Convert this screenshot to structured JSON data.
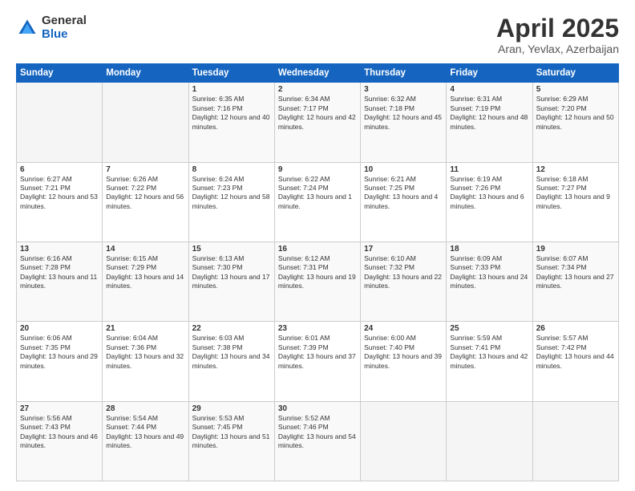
{
  "header": {
    "logo_general": "General",
    "logo_blue": "Blue",
    "title": "April 2025",
    "subtitle": "Aran, Yevlax, Azerbaijan"
  },
  "weekdays": [
    "Sunday",
    "Monday",
    "Tuesday",
    "Wednesday",
    "Thursday",
    "Friday",
    "Saturday"
  ],
  "weeks": [
    [
      {
        "day": "",
        "sunrise": "",
        "sunset": "",
        "daylight": "",
        "empty": true
      },
      {
        "day": "",
        "sunrise": "",
        "sunset": "",
        "daylight": "",
        "empty": true
      },
      {
        "day": "1",
        "sunrise": "Sunrise: 6:35 AM",
        "sunset": "Sunset: 7:16 PM",
        "daylight": "Daylight: 12 hours and 40 minutes.",
        "empty": false
      },
      {
        "day": "2",
        "sunrise": "Sunrise: 6:34 AM",
        "sunset": "Sunset: 7:17 PM",
        "daylight": "Daylight: 12 hours and 42 minutes.",
        "empty": false
      },
      {
        "day": "3",
        "sunrise": "Sunrise: 6:32 AM",
        "sunset": "Sunset: 7:18 PM",
        "daylight": "Daylight: 12 hours and 45 minutes.",
        "empty": false
      },
      {
        "day": "4",
        "sunrise": "Sunrise: 6:31 AM",
        "sunset": "Sunset: 7:19 PM",
        "daylight": "Daylight: 12 hours and 48 minutes.",
        "empty": false
      },
      {
        "day": "5",
        "sunrise": "Sunrise: 6:29 AM",
        "sunset": "Sunset: 7:20 PM",
        "daylight": "Daylight: 12 hours and 50 minutes.",
        "empty": false
      }
    ],
    [
      {
        "day": "6",
        "sunrise": "Sunrise: 6:27 AM",
        "sunset": "Sunset: 7:21 PM",
        "daylight": "Daylight: 12 hours and 53 minutes.",
        "empty": false
      },
      {
        "day": "7",
        "sunrise": "Sunrise: 6:26 AM",
        "sunset": "Sunset: 7:22 PM",
        "daylight": "Daylight: 12 hours and 56 minutes.",
        "empty": false
      },
      {
        "day": "8",
        "sunrise": "Sunrise: 6:24 AM",
        "sunset": "Sunset: 7:23 PM",
        "daylight": "Daylight: 12 hours and 58 minutes.",
        "empty": false
      },
      {
        "day": "9",
        "sunrise": "Sunrise: 6:22 AM",
        "sunset": "Sunset: 7:24 PM",
        "daylight": "Daylight: 13 hours and 1 minute.",
        "empty": false
      },
      {
        "day": "10",
        "sunrise": "Sunrise: 6:21 AM",
        "sunset": "Sunset: 7:25 PM",
        "daylight": "Daylight: 13 hours and 4 minutes.",
        "empty": false
      },
      {
        "day": "11",
        "sunrise": "Sunrise: 6:19 AM",
        "sunset": "Sunset: 7:26 PM",
        "daylight": "Daylight: 13 hours and 6 minutes.",
        "empty": false
      },
      {
        "day": "12",
        "sunrise": "Sunrise: 6:18 AM",
        "sunset": "Sunset: 7:27 PM",
        "daylight": "Daylight: 13 hours and 9 minutes.",
        "empty": false
      }
    ],
    [
      {
        "day": "13",
        "sunrise": "Sunrise: 6:16 AM",
        "sunset": "Sunset: 7:28 PM",
        "daylight": "Daylight: 13 hours and 11 minutes.",
        "empty": false
      },
      {
        "day": "14",
        "sunrise": "Sunrise: 6:15 AM",
        "sunset": "Sunset: 7:29 PM",
        "daylight": "Daylight: 13 hours and 14 minutes.",
        "empty": false
      },
      {
        "day": "15",
        "sunrise": "Sunrise: 6:13 AM",
        "sunset": "Sunset: 7:30 PM",
        "daylight": "Daylight: 13 hours and 17 minutes.",
        "empty": false
      },
      {
        "day": "16",
        "sunrise": "Sunrise: 6:12 AM",
        "sunset": "Sunset: 7:31 PM",
        "daylight": "Daylight: 13 hours and 19 minutes.",
        "empty": false
      },
      {
        "day": "17",
        "sunrise": "Sunrise: 6:10 AM",
        "sunset": "Sunset: 7:32 PM",
        "daylight": "Daylight: 13 hours and 22 minutes.",
        "empty": false
      },
      {
        "day": "18",
        "sunrise": "Sunrise: 6:09 AM",
        "sunset": "Sunset: 7:33 PM",
        "daylight": "Daylight: 13 hours and 24 minutes.",
        "empty": false
      },
      {
        "day": "19",
        "sunrise": "Sunrise: 6:07 AM",
        "sunset": "Sunset: 7:34 PM",
        "daylight": "Daylight: 13 hours and 27 minutes.",
        "empty": false
      }
    ],
    [
      {
        "day": "20",
        "sunrise": "Sunrise: 6:06 AM",
        "sunset": "Sunset: 7:35 PM",
        "daylight": "Daylight: 13 hours and 29 minutes.",
        "empty": false
      },
      {
        "day": "21",
        "sunrise": "Sunrise: 6:04 AM",
        "sunset": "Sunset: 7:36 PM",
        "daylight": "Daylight: 13 hours and 32 minutes.",
        "empty": false
      },
      {
        "day": "22",
        "sunrise": "Sunrise: 6:03 AM",
        "sunset": "Sunset: 7:38 PM",
        "daylight": "Daylight: 13 hours and 34 minutes.",
        "empty": false
      },
      {
        "day": "23",
        "sunrise": "Sunrise: 6:01 AM",
        "sunset": "Sunset: 7:39 PM",
        "daylight": "Daylight: 13 hours and 37 minutes.",
        "empty": false
      },
      {
        "day": "24",
        "sunrise": "Sunrise: 6:00 AM",
        "sunset": "Sunset: 7:40 PM",
        "daylight": "Daylight: 13 hours and 39 minutes.",
        "empty": false
      },
      {
        "day": "25",
        "sunrise": "Sunrise: 5:59 AM",
        "sunset": "Sunset: 7:41 PM",
        "daylight": "Daylight: 13 hours and 42 minutes.",
        "empty": false
      },
      {
        "day": "26",
        "sunrise": "Sunrise: 5:57 AM",
        "sunset": "Sunset: 7:42 PM",
        "daylight": "Daylight: 13 hours and 44 minutes.",
        "empty": false
      }
    ],
    [
      {
        "day": "27",
        "sunrise": "Sunrise: 5:56 AM",
        "sunset": "Sunset: 7:43 PM",
        "daylight": "Daylight: 13 hours and 46 minutes.",
        "empty": false
      },
      {
        "day": "28",
        "sunrise": "Sunrise: 5:54 AM",
        "sunset": "Sunset: 7:44 PM",
        "daylight": "Daylight: 13 hours and 49 minutes.",
        "empty": false
      },
      {
        "day": "29",
        "sunrise": "Sunrise: 5:53 AM",
        "sunset": "Sunset: 7:45 PM",
        "daylight": "Daylight: 13 hours and 51 minutes.",
        "empty": false
      },
      {
        "day": "30",
        "sunrise": "Sunrise: 5:52 AM",
        "sunset": "Sunset: 7:46 PM",
        "daylight": "Daylight: 13 hours and 54 minutes.",
        "empty": false
      },
      {
        "day": "",
        "sunrise": "",
        "sunset": "",
        "daylight": "",
        "empty": true
      },
      {
        "day": "",
        "sunrise": "",
        "sunset": "",
        "daylight": "",
        "empty": true
      },
      {
        "day": "",
        "sunrise": "",
        "sunset": "",
        "daylight": "",
        "empty": true
      }
    ]
  ]
}
